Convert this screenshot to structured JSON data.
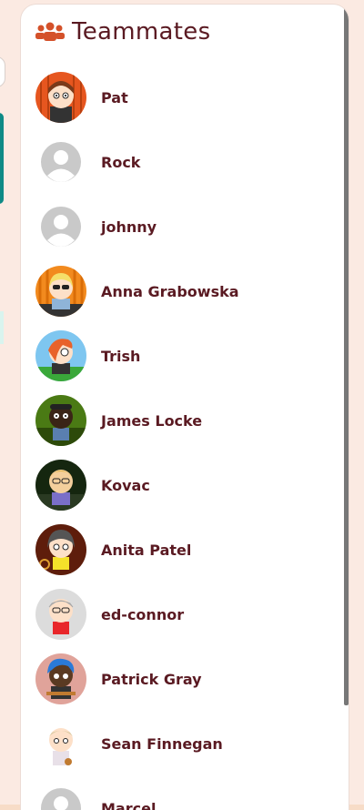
{
  "panel": {
    "title": "Teammates",
    "title_icon": "people-group-icon",
    "title_color": "#5a1a22",
    "accent": "#d4512a"
  },
  "teammates": [
    {
      "name": "Pat",
      "avatar": "cartoon-avatar-orange"
    },
    {
      "name": "Rock",
      "avatar": "default-user-avatar"
    },
    {
      "name": "johnny",
      "avatar": "default-user-avatar"
    },
    {
      "name": "Anna Grabowska",
      "avatar": "cartoon-avatar-orange-stripes"
    },
    {
      "name": "Trish",
      "avatar": "cartoon-avatar-sky"
    },
    {
      "name": "James Locke",
      "avatar": "cartoon-avatar-green"
    },
    {
      "name": "Kovac",
      "avatar": "cartoon-avatar-dark-green"
    },
    {
      "name": "Anita Patel",
      "avatar": "cartoon-avatar-brown"
    },
    {
      "name": "ed-connor",
      "avatar": "cartoon-avatar-grey"
    },
    {
      "name": "Patrick Gray",
      "avatar": "cartoon-avatar-pink"
    },
    {
      "name": "Sean Finnegan",
      "avatar": "cartoon-avatar-white"
    },
    {
      "name": "Marcel",
      "avatar": "default-user-avatar"
    }
  ]
}
